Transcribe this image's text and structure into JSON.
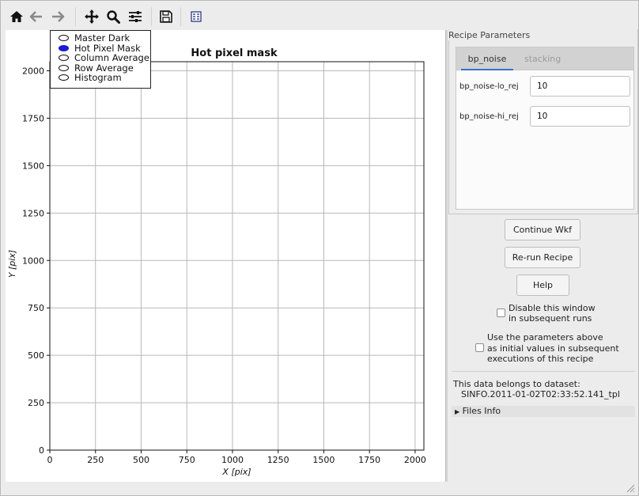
{
  "toolbar": {
    "icons": [
      "home-icon",
      "back-arrow-icon",
      "forward-arrow-icon",
      "pan-icon",
      "zoom-icon",
      "configure-subplots-icon",
      "save-icon",
      "edit-axis-icon"
    ]
  },
  "plot": {
    "legend": [
      "Master Dark",
      "Hot Pixel Mask",
      "Column Average",
      "Row Average",
      "Histogram"
    ],
    "legend_selected": 1
  },
  "chart_data": {
    "type": "scatter",
    "title": "Hot pixel mask",
    "xlabel": "X [pix]",
    "ylabel": "Y [pix]",
    "xlim": [
      0,
      2048
    ],
    "ylim": [
      0,
      2048
    ],
    "xticks": [
      0,
      250,
      500,
      750,
      1000,
      1250,
      1500,
      1750,
      2000
    ],
    "yticks": [
      0,
      250,
      500,
      750,
      1000,
      1250,
      1500,
      1750,
      2000
    ],
    "grid": true,
    "series": []
  },
  "recipe": {
    "group_title": "Recipe Parameters",
    "tabs": [
      "bp_noise",
      "stacking"
    ],
    "active_tab": 0,
    "params": [
      {
        "label": "bp_noise-lo_rej",
        "value": "10"
      },
      {
        "label": "bp_noise-hi_rej",
        "value": "10"
      }
    ]
  },
  "buttons": {
    "continue": "Continue Wkf",
    "rerun": "Re-run Recipe",
    "help": "Help"
  },
  "options": {
    "disable_line1": "Disable this window",
    "disable_line2": "in subsequent runs",
    "use_line1": "Use the parameters above",
    "use_line2": "as initial values in subsequent",
    "use_line3": "executions of this recipe"
  },
  "dataset": {
    "label": "This data belongs to dataset:",
    "name": "SINFO.2011-01-02T02:33:52.141_tpl"
  },
  "files_info": "Files Info"
}
